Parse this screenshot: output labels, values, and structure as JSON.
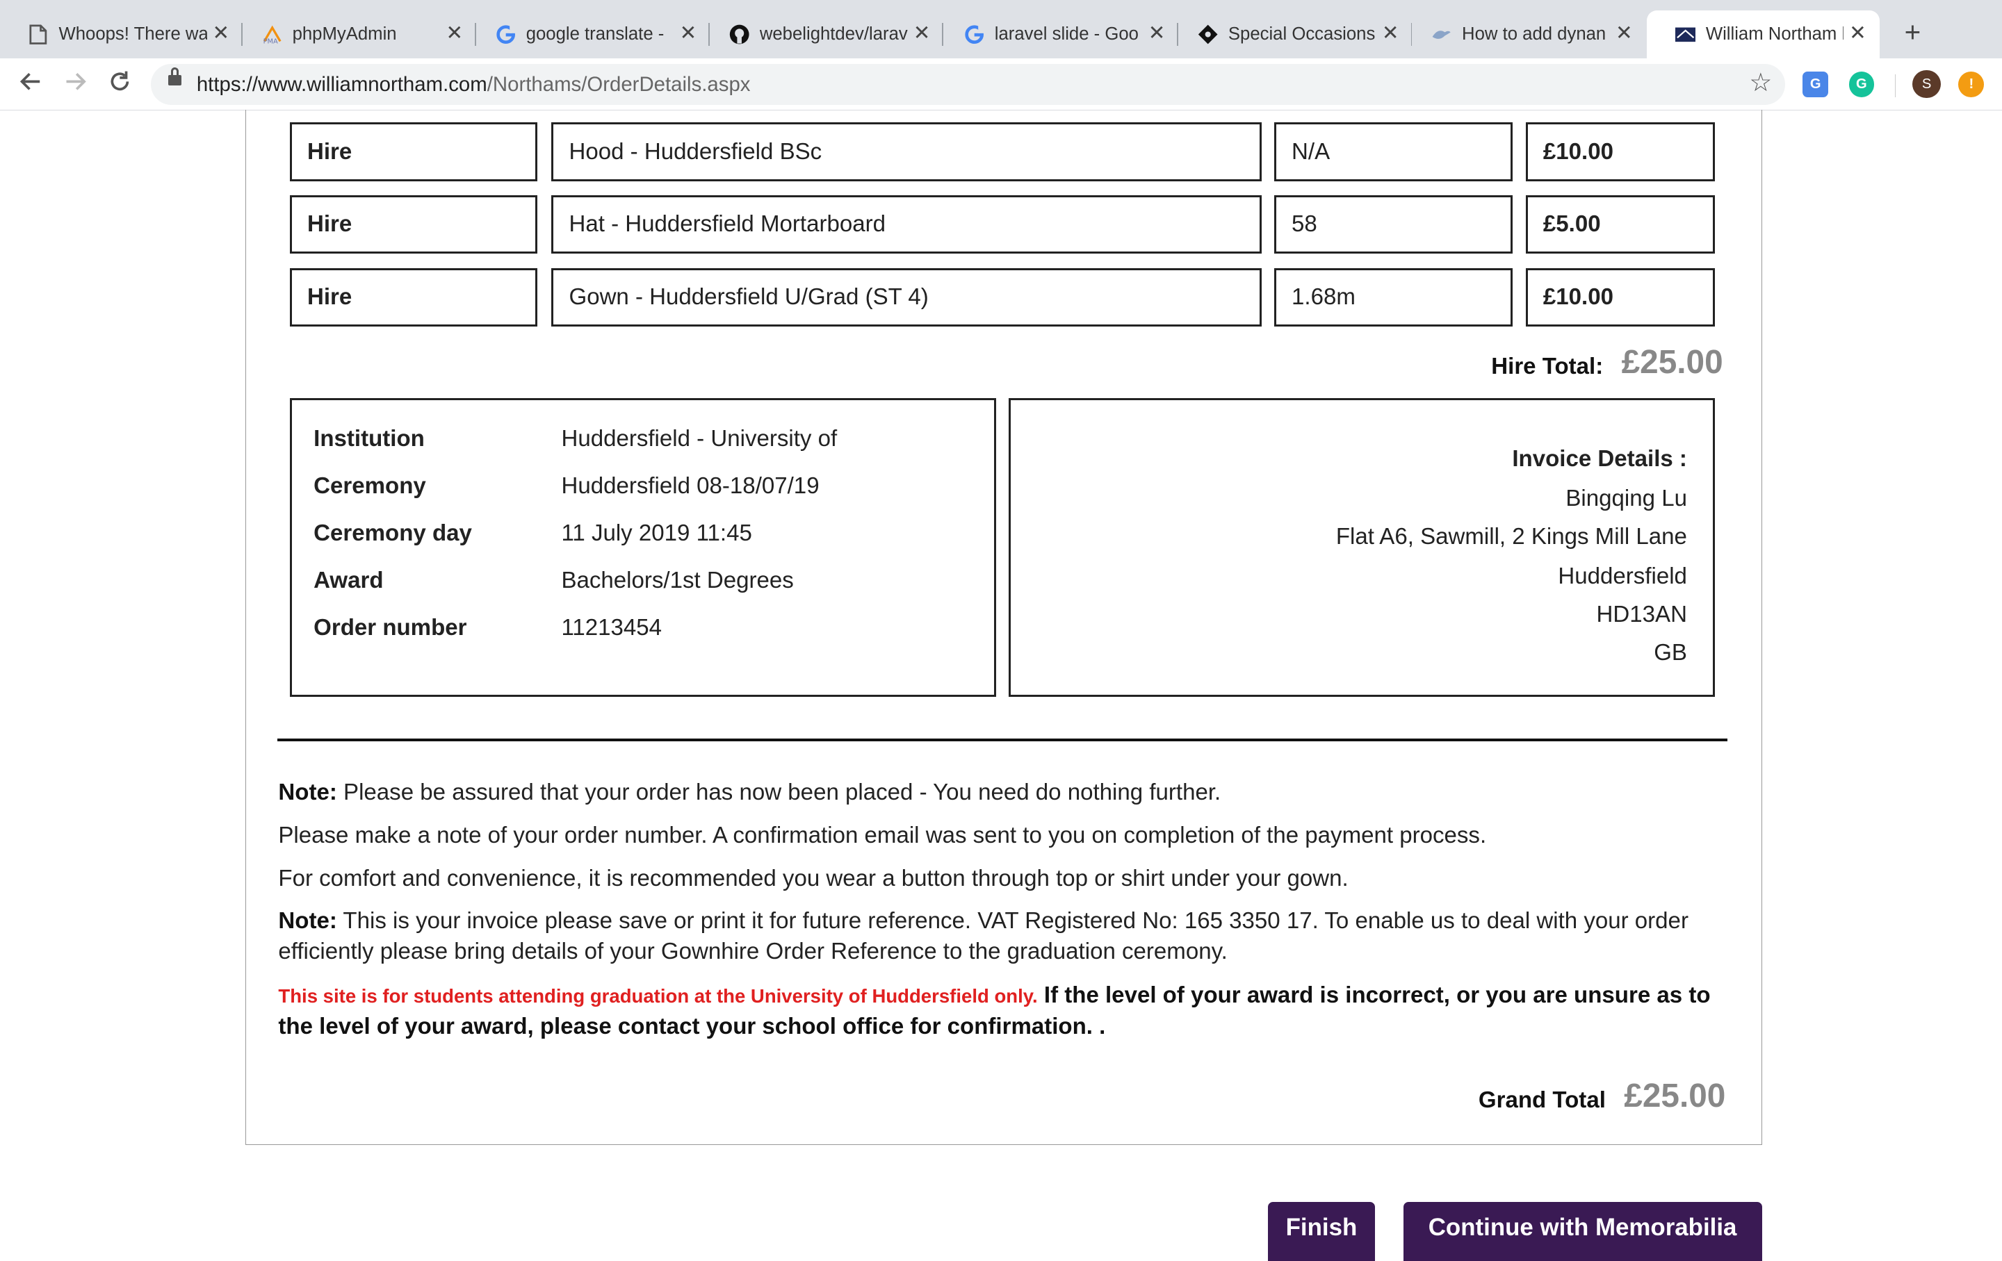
{
  "browser": {
    "tabs": [
      {
        "title": "Whoops! There wa",
        "icon": "document-icon"
      },
      {
        "title": "phpMyAdmin",
        "icon": "phpmyadmin-icon"
      },
      {
        "title": "google translate -",
        "icon": "google-icon"
      },
      {
        "title": "webelightdev/larav",
        "icon": "github-icon"
      },
      {
        "title": "laravel slide - Goo",
        "icon": "google-icon"
      },
      {
        "title": "Special Occasions",
        "icon": "diamond-icon"
      },
      {
        "title": "How to add dynan",
        "icon": "bird-icon"
      },
      {
        "title": "William Northam h",
        "icon": "northam-icon",
        "active": true
      }
    ],
    "url_host": "https://www.williamnortham.com",
    "url_path": "/Northams/OrderDetails.aspx",
    "avatar_letter": "S"
  },
  "hire_items": [
    {
      "type": "Hire",
      "item": "Hood - Huddersfield BSc",
      "size": "N/A",
      "price": "£10.00"
    },
    {
      "type": "Hire",
      "item": "Hat - Huddersfield Mortarboard",
      "size": "58",
      "price": "£5.00"
    },
    {
      "type": "Hire",
      "item": "Gown - Huddersfield U/Grad (ST 4)",
      "size": "1.68m",
      "price": "£10.00"
    }
  ],
  "hire_total": {
    "label": "Hire Total:",
    "value": "£25.00"
  },
  "details": [
    {
      "label": "Institution",
      "value": "Huddersfield - University of"
    },
    {
      "label": "Ceremony",
      "value": "Huddersfield 08-18/07/19"
    },
    {
      "label": "Ceremony day",
      "value": "11 July 2019 11:45"
    },
    {
      "label": "Award",
      "value": "Bachelors/1st Degrees"
    },
    {
      "label": "Order number",
      "value": "11213454"
    }
  ],
  "invoice": {
    "heading": "Invoice Details :",
    "lines": [
      "Bingqing Lu",
      "Flat A6, Sawmill, 2 Kings Mill Lane",
      "Huddersfield",
      "HD13AN",
      "GB"
    ]
  },
  "notes": {
    "note_label": "Note:",
    "note1": " Please be assured that your order has now been placed - You need do nothing further.",
    "note2": "Please make a note of your order number. A confirmation email was sent to you on completion of the payment process.",
    "note3": "For comfort and convenience, it is recommended you wear a button through top or shirt under your gown.",
    "note4": " This is your invoice please save or print it for future reference. VAT Registered No: 165 3350 17. To enable us to deal with your order efficiently please bring details of your Gownhire Order Reference to the graduation ceremony.",
    "warning_red": "This site is for students attending graduation at the University of Huddersfield only.",
    "warning_bold": " If the level of your award is incorrect, or you are unsure as to the level of your award, please contact your school office for confirmation. ."
  },
  "grand_total": {
    "label": "Grand Total",
    "value": "£25.00"
  },
  "buttons": {
    "finish": "Finish",
    "continue": "Continue with Memorabilia"
  },
  "colors": {
    "button_bg": "#3a1a54",
    "warning_red": "#e02020",
    "total_grey": "#888888"
  }
}
